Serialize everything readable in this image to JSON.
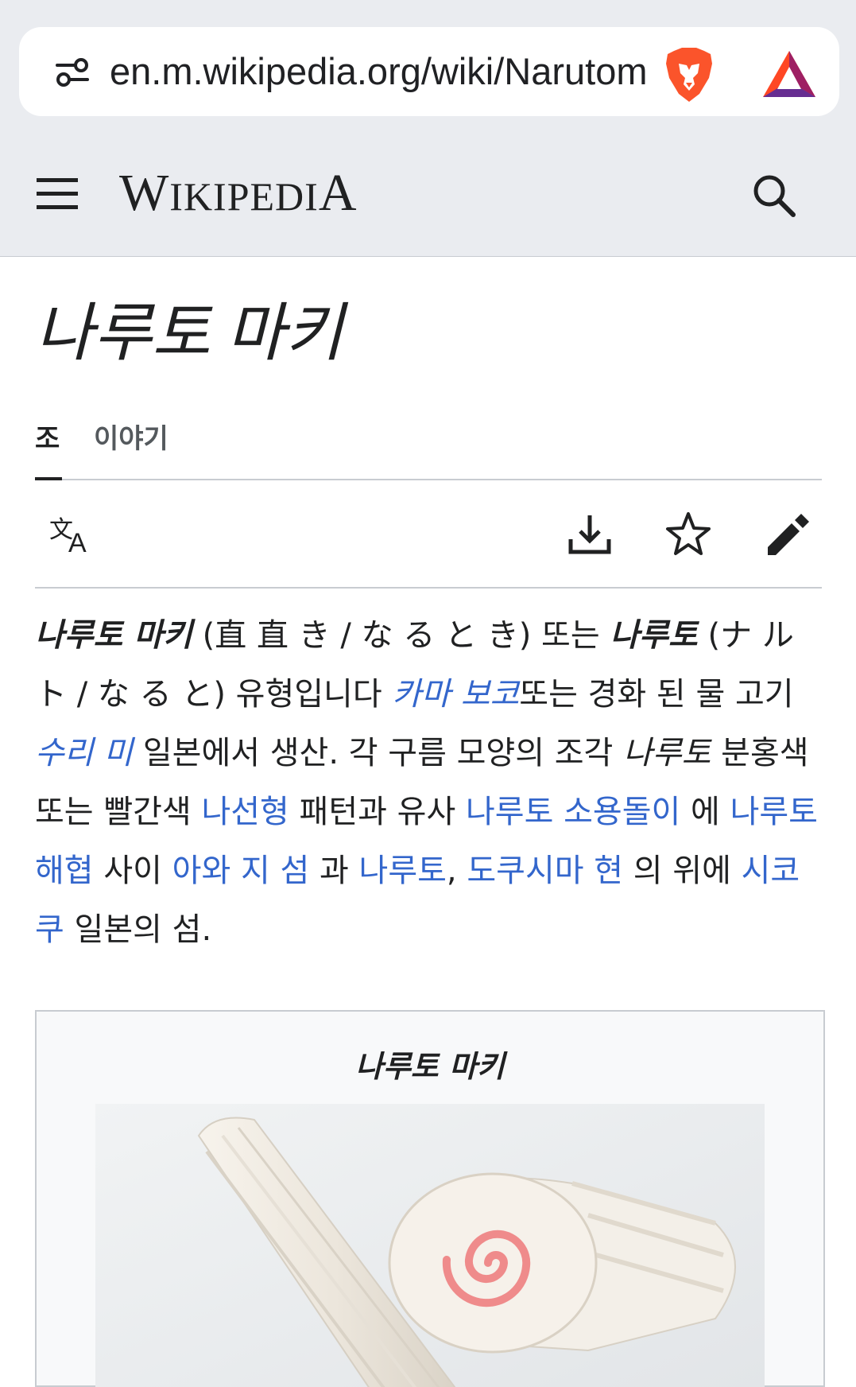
{
  "browser": {
    "url": "en.m.wikipedia.org/wiki/Narutom"
  },
  "header": {
    "wordmark_first": "W",
    "wordmark_small": "IKIPEDI",
    "wordmark_last": "A"
  },
  "page": {
    "title": "나루토 마키"
  },
  "tabs": [
    {
      "label": "조"
    },
    {
      "label": "이야기"
    }
  ],
  "toolbar": {
    "icons": [
      "language-icon",
      "download-icon",
      "star-icon",
      "edit-icon"
    ]
  },
  "article": {
    "segments": [
      {
        "text": "나루토 마키",
        "style": "bold-italic"
      },
      {
        "text": " (直 直 き / な る と き) 또는 ",
        "style": "normal"
      },
      {
        "text": "나루토",
        "style": "bold-italic"
      },
      {
        "text": " (ナ ル ト / な る と) 유형입니다 ",
        "style": "normal"
      },
      {
        "text": "카마 보코",
        "style": "link-italic"
      },
      {
        "text": "또는 경화 된 물 고기 ",
        "style": "normal"
      },
      {
        "text": "수리 미",
        "style": "link-italic"
      },
      {
        "text": " 일본에서 생산. 각 구름 모양의 조각 ",
        "style": "normal"
      },
      {
        "text": "나루토",
        "style": "italic"
      },
      {
        "text": " 분홍색 또는 빨간색 ",
        "style": "normal"
      },
      {
        "text": "나선형",
        "style": "link"
      },
      {
        "text": " 패턴과 유사 ",
        "style": "normal"
      },
      {
        "text": "나루토 소용돌이",
        "style": "link"
      },
      {
        "text": " 에 ",
        "style": "normal"
      },
      {
        "text": "나루토 해협",
        "style": "link"
      },
      {
        "text": " 사이 ",
        "style": "normal"
      },
      {
        "text": "아와 지 섬",
        "style": "link"
      },
      {
        "text": " 과 ",
        "style": "normal"
      },
      {
        "text": "나루토",
        "style": "link"
      },
      {
        "text": ", ",
        "style": "normal"
      },
      {
        "text": "도쿠시마 현",
        "style": "link"
      },
      {
        "text": " 의 위에 ",
        "style": "normal"
      },
      {
        "text": "시코쿠",
        "style": "link"
      },
      {
        "text": " 일본의 섬.",
        "style": "normal"
      }
    ]
  },
  "infobox": {
    "caption": "나루토 마키"
  },
  "colors": {
    "link": "#3366cc",
    "chrome": "#eaecf0",
    "text": "#202122"
  }
}
